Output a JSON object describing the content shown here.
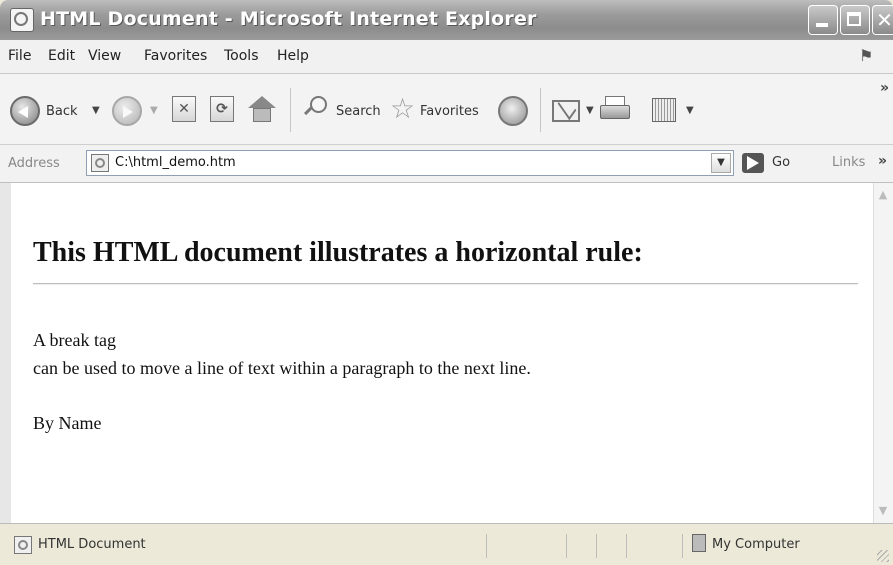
{
  "window": {
    "title": "HTML Document - Microsoft Internet Explorer"
  },
  "menu": [
    "File",
    "Edit",
    "View",
    "Favorites",
    "Tools",
    "Help"
  ],
  "toolbar": {
    "back_label": "Back",
    "search_label": "Search",
    "favorites_label": "Favorites"
  },
  "address": {
    "label": "Address",
    "value": "C:\\html_demo.htm",
    "go_label": "Go",
    "links_label": "Links"
  },
  "document": {
    "heading": "This HTML document illustrates a horizontal rule:",
    "line1": "A break tag",
    "line2": "can be used to move a line of text within a paragraph to the next line.",
    "signature": "By Name"
  },
  "status": {
    "text": "HTML Document",
    "zone": "My Computer"
  }
}
